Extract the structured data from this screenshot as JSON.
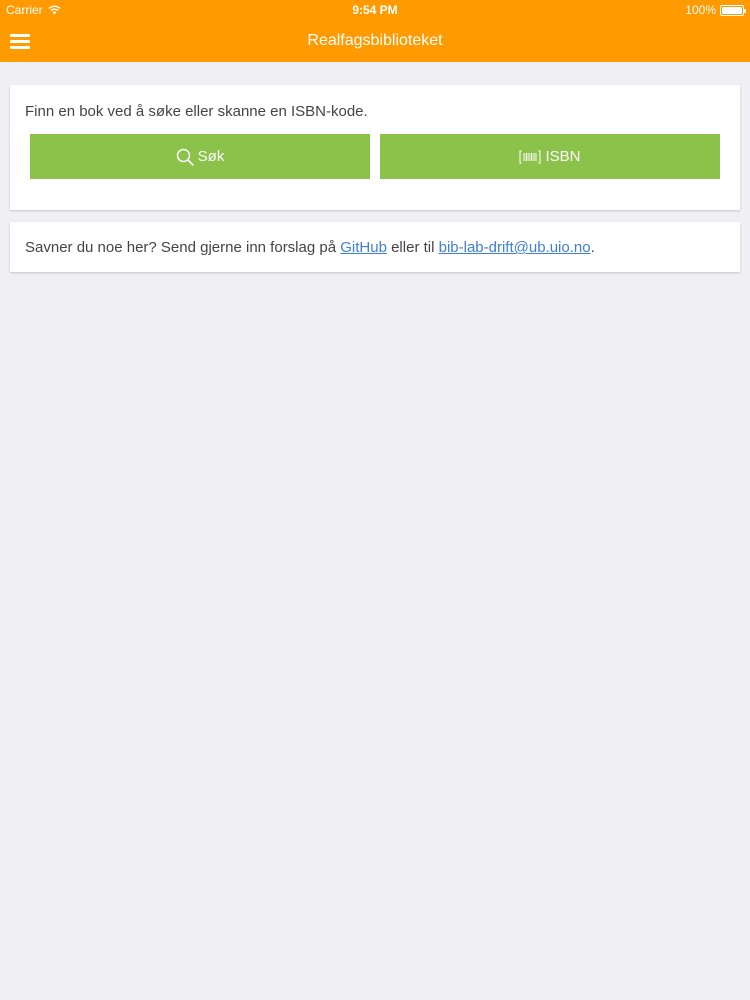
{
  "status_bar": {
    "carrier": "Carrier",
    "time": "9:54 PM",
    "battery": "100%"
  },
  "nav": {
    "title": "Realfagsbiblioteket",
    "menu_icon": "hamburger-icon"
  },
  "search_card": {
    "intro": "Finn en bok ved å søke eller skanne en ISBN-kode.",
    "search_button": {
      "icon": "search-icon",
      "label": "Søk"
    },
    "isbn_button": {
      "icon": "barcode-icon",
      "label": "ISBN"
    }
  },
  "info_card": {
    "text_before": "Savner du noe her? Send gjerne inn forslag på ",
    "github_link": "GitHub",
    "text_middle": " eller til ",
    "email_link": "bib-lab-drift@ub.uio.no",
    "text_after": "."
  },
  "colors": {
    "header": "#ff9a00",
    "button": "#8bc34a",
    "background": "#efeff4",
    "link": "#3f7fd6"
  }
}
